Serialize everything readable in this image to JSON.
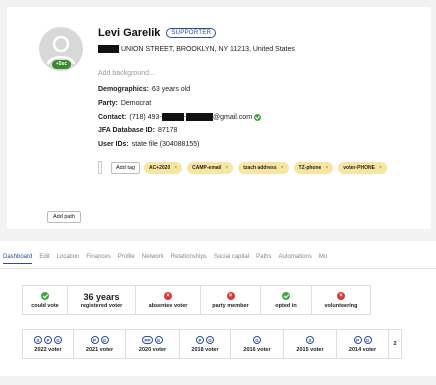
{
  "profile": {
    "avatar_badge": "+5sc",
    "name": "Levi Garelik",
    "status_badge": "SUPPORTER",
    "address": "UNION STREET, BROOKLYN, NY 11213, United States",
    "add_background_placeholder": "Add background...",
    "demographics_label": "Demographics:",
    "demographics_value": "63 years old",
    "party_label": "Party:",
    "party_value": "Democrat",
    "contact_label": "Contact:",
    "contact_phone_prefix": "(718) 493-",
    "contact_dash": " - ",
    "contact_email_suffix": "@gmail.com",
    "jfa_label": "JFA Database ID:",
    "jfa_value": "87178",
    "userids_label": "User IDs:",
    "userids_value": "state file (304088155)"
  },
  "tags": {
    "add_label": "Add tag",
    "items": [
      "AC+2020",
      "CAMP-email",
      "tzach address",
      "TZ-phone",
      "voter-PHONE"
    ]
  },
  "add_path_label": "Add path",
  "tabs": [
    "Dashboard",
    "Edit",
    "Location",
    "Finances",
    "Profile",
    "Network",
    "Relationships",
    "Social capital",
    "Paths",
    "Automations",
    "Mo"
  ],
  "stats": [
    {
      "label": "could vote",
      "icon": "ok"
    },
    {
      "label": "registered voter",
      "big": "36 years"
    },
    {
      "label": "absentee voter",
      "icon": "no"
    },
    {
      "label": "party member",
      "icon": "no"
    },
    {
      "label": "opted in",
      "icon": "ok"
    },
    {
      "label": "volunteering",
      "icon": "no"
    }
  ],
  "votes": [
    {
      "label": "2022 voter",
      "badges": [
        "S",
        "P",
        "G"
      ]
    },
    {
      "label": "2021 voter",
      "badges": [
        "P",
        "G"
      ]
    },
    {
      "label": "2020 voter",
      "badges": [
        "PP",
        "G"
      ]
    },
    {
      "label": "2018 voter",
      "badges": [
        "P",
        "G"
      ]
    },
    {
      "label": "2016 voter",
      "badges": [
        "G"
      ]
    },
    {
      "label": "2015 voter",
      "badges": [
        "S"
      ]
    },
    {
      "label": "2014 voter",
      "badges": [
        "P",
        "G"
      ]
    },
    {
      "label": "2",
      "badges": []
    }
  ],
  "colors": {
    "accent": "#2a4d9b",
    "tag_bg": "#f7e6a2",
    "ok": "#45a34a",
    "no": "#d63a2f"
  }
}
